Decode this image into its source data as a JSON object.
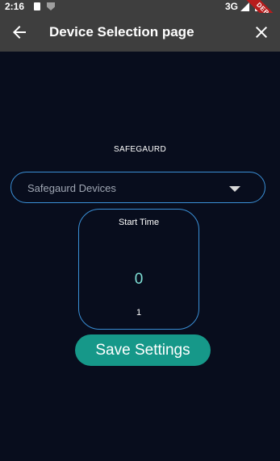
{
  "status_bar": {
    "time": "2:16",
    "network": "3G",
    "debug_banner": "DEBUG"
  },
  "app_bar": {
    "title": "Device Selection page",
    "back_icon": "arrow-back-icon",
    "close_icon": "close-icon"
  },
  "section": {
    "label": "SAFEGAURD"
  },
  "dropdown": {
    "selected": "Safegaurd Devices",
    "icon": "chevron-down-icon"
  },
  "start_time_picker": {
    "title": "Start Time",
    "value": "0",
    "next_value": "1"
  },
  "save_button": {
    "label": "Save Settings"
  },
  "colors": {
    "background": "#080d1d",
    "app_bar": "#3e3e3e",
    "accent_border": "#3a8fd6",
    "button": "#169889",
    "picker_selected": "#7fe0d6"
  }
}
